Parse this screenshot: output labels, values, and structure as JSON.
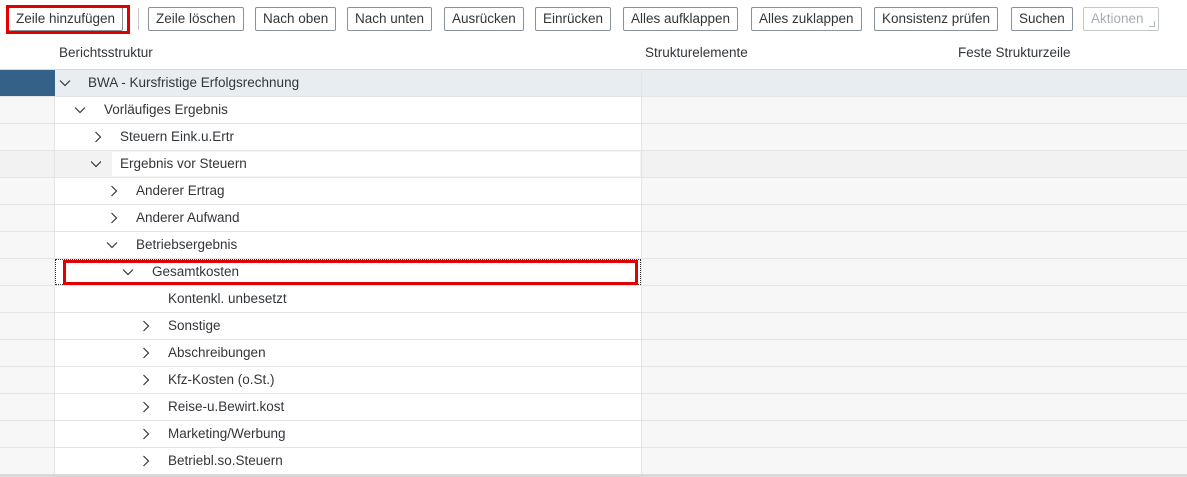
{
  "toolbar": {
    "buttons": [
      {
        "label": "Zeile hinzufügen"
      },
      {
        "label": "Zeile löschen"
      },
      {
        "label": "Nach oben"
      },
      {
        "label": "Nach unten"
      },
      {
        "label": "Ausrücken"
      },
      {
        "label": "Einrücken"
      },
      {
        "label": "Alles aufklappen"
      },
      {
        "label": "Alles zuklappen"
      },
      {
        "label": "Konsistenz prüfen"
      },
      {
        "label": "Suchen"
      },
      {
        "label": "Aktionen",
        "disabled": true
      }
    ]
  },
  "table": {
    "columns": [
      "Berichtsstruktur",
      "Strukturelemente",
      "Feste Strukturzeile"
    ],
    "rows": [
      {
        "label": "BWA - Kursfristige Erfolgsrechnung",
        "chevron": "down"
      },
      {
        "label": "Vorläufiges Ergebnis",
        "chevron": "down"
      },
      {
        "label": "Steuern Eink.u.Ertr",
        "chevron": "right"
      },
      {
        "label": "Ergebnis vor Steuern",
        "chevron": "down"
      },
      {
        "label": "Anderer Ertrag",
        "chevron": "right"
      },
      {
        "label": "Anderer Aufwand",
        "chevron": "right"
      },
      {
        "label": "Betriebsergebnis",
        "chevron": "down"
      },
      {
        "label": "Gesamtkosten",
        "chevron": "down"
      },
      {
        "label": "Kontenkl. unbesetzt",
        "chevron": "none"
      },
      {
        "label": "Sonstige",
        "chevron": "right"
      },
      {
        "label": "Abschreibungen",
        "chevron": "right"
      },
      {
        "label": "Kfz-Kosten (o.St.)",
        "chevron": "right"
      },
      {
        "label": "Reise-u.Bewirt.kost",
        "chevron": "right"
      },
      {
        "label": "Marketing/Werbung",
        "chevron": "right"
      },
      {
        "label": "Betriebl.so.Steuern",
        "chevron": "right"
      }
    ]
  },
  "colors": {
    "highlight": "#e00000",
    "selected_row_marker": "#346187",
    "header_row_bg": "#e8edf2"
  }
}
